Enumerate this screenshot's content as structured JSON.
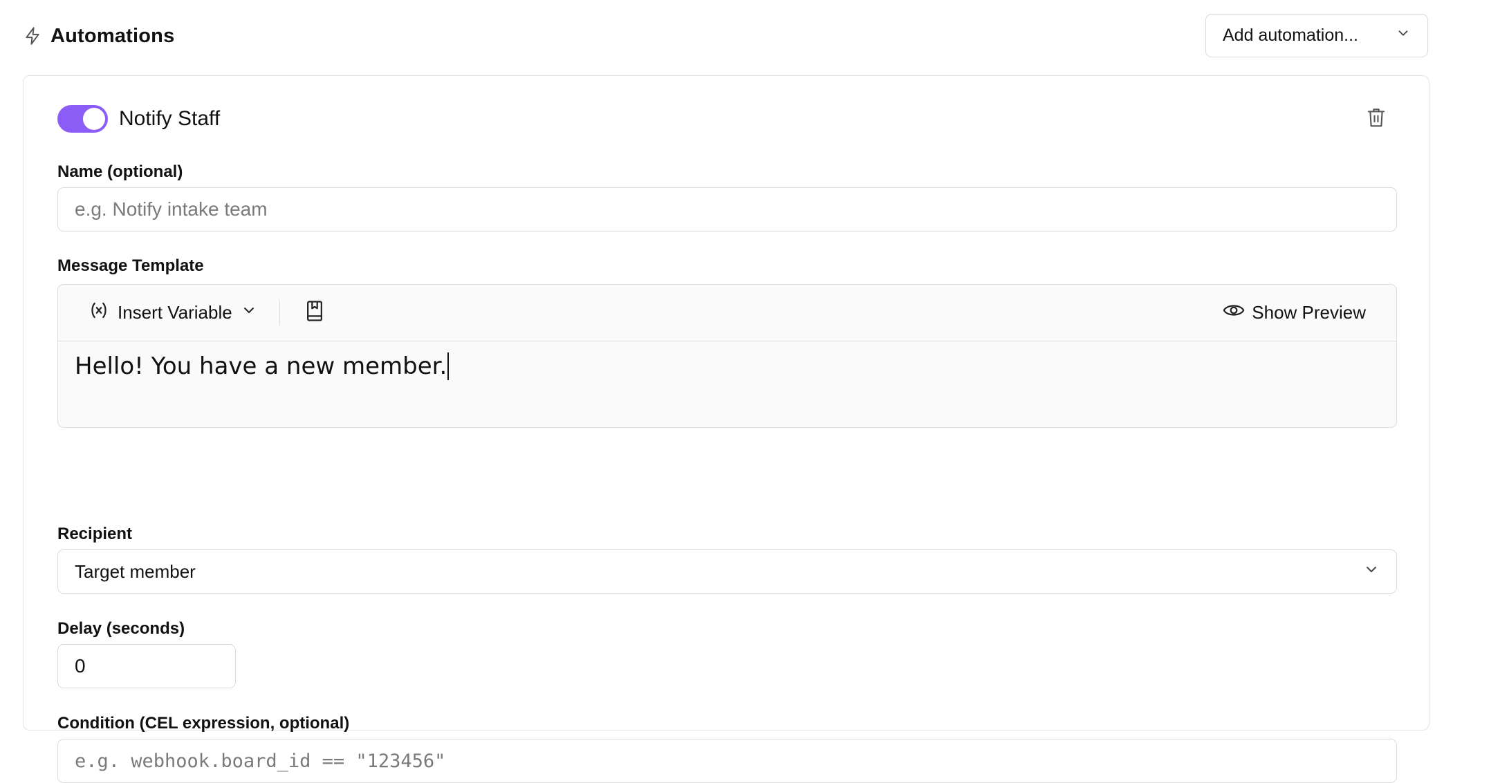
{
  "header": {
    "title": "Automations",
    "icon": "lightning-icon"
  },
  "add_automation": {
    "label": "Add automation..."
  },
  "automation": {
    "enabled": true,
    "accent_color": "#8b5cf6",
    "title": "Notify Staff",
    "name_field": {
      "label": "Name (optional)",
      "placeholder": "e.g. Notify intake team",
      "value": ""
    },
    "message_template": {
      "label": "Message Template",
      "insert_variable_label": "Insert Variable",
      "show_preview_label": "Show Preview",
      "content": "Hello! You have a new member."
    },
    "recipient": {
      "label": "Recipient",
      "selected": "Target member"
    },
    "delay": {
      "label": "Delay (seconds)",
      "value": "0"
    },
    "condition": {
      "label": "Condition (CEL expression, optional)",
      "placeholder": "e.g. webhook.board_id == \"123456\"",
      "value": ""
    }
  }
}
